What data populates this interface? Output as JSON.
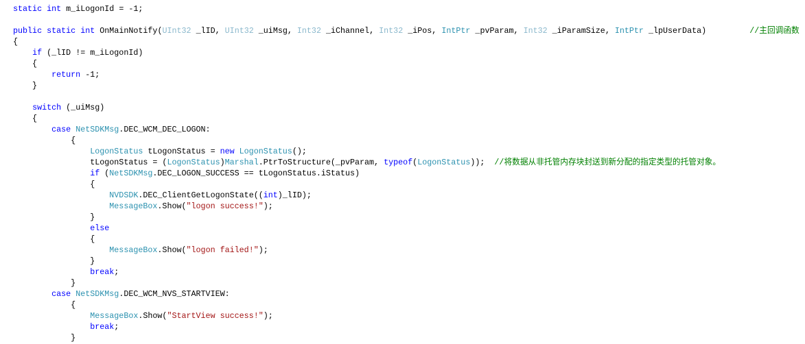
{
  "colors": {
    "keyword": "#0000ff",
    "type": "#2b91af",
    "light_type": "#8ab8cc",
    "string": "#a31515",
    "comment": "#008000"
  },
  "code_lines": [
    [
      [
        "static",
        "kw"
      ],
      [
        " ",
        ""
      ],
      [
        "int",
        "kw"
      ],
      [
        " m_iLogonId = -1;",
        ""
      ]
    ],
    [],
    [
      [
        "public",
        "kw"
      ],
      [
        " ",
        ""
      ],
      [
        "static",
        "kw"
      ],
      [
        " ",
        ""
      ],
      [
        "int",
        "kw"
      ],
      [
        " OnMainNotify(",
        ""
      ],
      [
        "UInt32",
        "tl"
      ],
      [
        " _lID, ",
        ""
      ],
      [
        "UInt32",
        "tl"
      ],
      [
        " _uiMsg, ",
        ""
      ],
      [
        "Int32",
        "tl"
      ],
      [
        " _iChannel, ",
        ""
      ],
      [
        "Int32",
        "tl"
      ],
      [
        " _iPos, ",
        ""
      ],
      [
        "IntPtr",
        "ty"
      ],
      [
        " _pvParam, ",
        ""
      ],
      [
        "Int32",
        "tl"
      ],
      [
        " _iParamSize, ",
        ""
      ],
      [
        "IntPtr",
        "ty"
      ],
      [
        " _lpUserData)         ",
        ""
      ],
      [
        "//主回调函数",
        "cm"
      ]
    ],
    [
      [
        "{",
        ""
      ]
    ],
    [
      [
        "    ",
        ""
      ],
      [
        "if",
        "kw"
      ],
      [
        " (_lID != m_iLogonId)",
        ""
      ]
    ],
    [
      [
        "    {",
        ""
      ]
    ],
    [
      [
        "        ",
        ""
      ],
      [
        "return",
        "kw"
      ],
      [
        " -1;",
        ""
      ]
    ],
    [
      [
        "    }",
        ""
      ]
    ],
    [],
    [
      [
        "    ",
        ""
      ],
      [
        "switch",
        "kw"
      ],
      [
        " (_uiMsg)",
        ""
      ]
    ],
    [
      [
        "    {",
        ""
      ]
    ],
    [
      [
        "        ",
        ""
      ],
      [
        "case",
        "kw"
      ],
      [
        " ",
        ""
      ],
      [
        "NetSDKMsg",
        "ty"
      ],
      [
        ".DEC_WCM_DEC_LOGON:",
        ""
      ]
    ],
    [
      [
        "            {",
        ""
      ]
    ],
    [
      [
        "                ",
        ""
      ],
      [
        "LogonStatus",
        "ty"
      ],
      [
        " tLogonStatus = ",
        ""
      ],
      [
        "new",
        "kw"
      ],
      [
        " ",
        ""
      ],
      [
        "LogonStatus",
        "ty"
      ],
      [
        "();",
        ""
      ]
    ],
    [
      [
        "                tLogonStatus = (",
        ""
      ],
      [
        "LogonStatus",
        "ty"
      ],
      [
        ")",
        ""
      ],
      [
        "Marshal",
        "ty"
      ],
      [
        ".PtrToStructure(_pvParam, ",
        ""
      ],
      [
        "typeof",
        "kw"
      ],
      [
        "(",
        ""
      ],
      [
        "LogonStatus",
        "ty"
      ],
      [
        "));  ",
        ""
      ],
      [
        "//将数据从非托管内存块封送到新分配的指定类型的托管对象。",
        "cm"
      ]
    ],
    [
      [
        "                ",
        ""
      ],
      [
        "if",
        "kw"
      ],
      [
        " (",
        ""
      ],
      [
        "NetSDKMsg",
        "ty"
      ],
      [
        ".DEC_LOGON_SUCCESS == tLogonStatus.iStatus)",
        ""
      ]
    ],
    [
      [
        "                {",
        ""
      ]
    ],
    [
      [
        "                    ",
        ""
      ],
      [
        "NVDSDK",
        "ty"
      ],
      [
        ".DEC_ClientGetLogonState((",
        ""
      ],
      [
        "int",
        "kw"
      ],
      [
        ")_lID);",
        ""
      ]
    ],
    [
      [
        "                    ",
        ""
      ],
      [
        "MessageBox",
        "ty"
      ],
      [
        ".Show(",
        ""
      ],
      [
        "\"logon success!\"",
        "st"
      ],
      [
        ");",
        ""
      ]
    ],
    [
      [
        "                }",
        ""
      ]
    ],
    [
      [
        "                ",
        ""
      ],
      [
        "else",
        "kw"
      ]
    ],
    [
      [
        "                {",
        ""
      ]
    ],
    [
      [
        "                    ",
        ""
      ],
      [
        "MessageBox",
        "ty"
      ],
      [
        ".Show(",
        ""
      ],
      [
        "\"logon failed!\"",
        "st"
      ],
      [
        ");",
        ""
      ]
    ],
    [
      [
        "                }",
        ""
      ]
    ],
    [
      [
        "                ",
        ""
      ],
      [
        "break",
        "kw"
      ],
      [
        ";",
        ""
      ]
    ],
    [
      [
        "            }",
        ""
      ]
    ],
    [
      [
        "        ",
        ""
      ],
      [
        "case",
        "kw"
      ],
      [
        " ",
        ""
      ],
      [
        "NetSDKMsg",
        "ty"
      ],
      [
        ".DEC_WCM_NVS_STARTVIEW:",
        ""
      ]
    ],
    [
      [
        "            {",
        ""
      ]
    ],
    [
      [
        "                ",
        ""
      ],
      [
        "MessageBox",
        "ty"
      ],
      [
        ".Show(",
        ""
      ],
      [
        "\"StartView success!\"",
        "st"
      ],
      [
        ");",
        ""
      ]
    ],
    [
      [
        "                ",
        ""
      ],
      [
        "break",
        "kw"
      ],
      [
        ";",
        ""
      ]
    ],
    [
      [
        "            }",
        ""
      ]
    ]
  ]
}
